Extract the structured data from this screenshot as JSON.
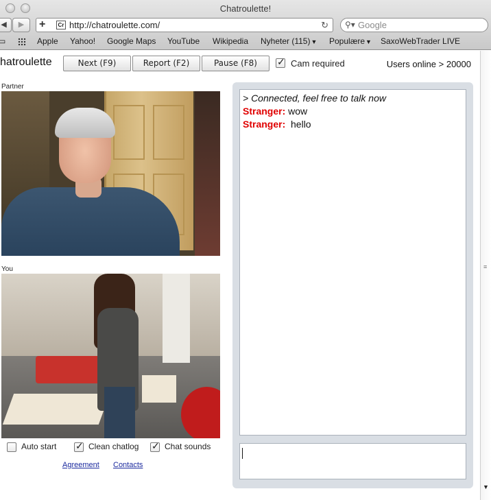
{
  "browser": {
    "title": "Chatroulette!",
    "url": "http://chatroulette.com/",
    "url_favicon": "Cr",
    "search_placeholder": "Google",
    "bookmarks": [
      "Apple",
      "Yahoo!",
      "Google Maps",
      "YouTube",
      "Wikipedia",
      "Nyheter (115)",
      "Populære",
      "SaxoWebTrader LIVE"
    ]
  },
  "header": {
    "brand": "hatroulette",
    "next_label": "Next (F9)",
    "report_label": "Report (F2)",
    "pause_label": "Pause (F8)",
    "cam_required_label": "Cam required",
    "cam_required_checked": true,
    "users_online": "Users online > 20000"
  },
  "videos": {
    "partner_label": "Partner",
    "you_label": "You"
  },
  "options": {
    "auto_start_label": "Auto start",
    "auto_start_checked": false,
    "clean_chatlog_label": "Clean chatlog",
    "clean_chatlog_checked": true,
    "chat_sounds_label": "Chat sounds",
    "chat_sounds_checked": true
  },
  "links": {
    "agreement": "Agreement",
    "contacts": "Contacts"
  },
  "chat": {
    "status": "> Connected, feel free to talk now",
    "messages": [
      {
        "speaker": "Stranger:",
        "text": "wow"
      },
      {
        "speaker": "Stranger:",
        "text": " hello"
      }
    ],
    "input_value": ""
  },
  "icons": {
    "back": "back-arrow-icon",
    "forward": "forward-arrow-icon",
    "add": "plus-icon",
    "reload": "reload-icon",
    "search": "search-icon",
    "bookmarks_grid": "grid-icon"
  },
  "colors": {
    "stranger": "#e00000",
    "link": "#1b2a9e",
    "chat_panel": "#d9dee4"
  }
}
